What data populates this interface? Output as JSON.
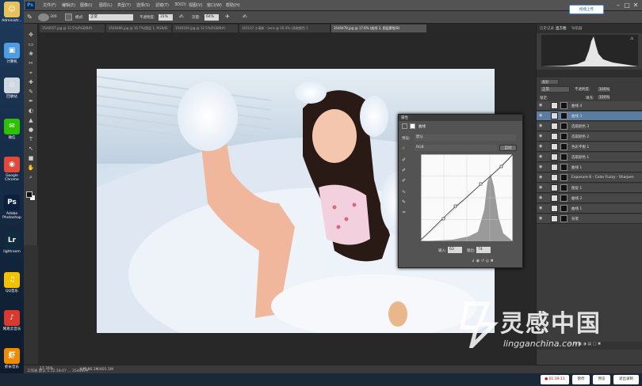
{
  "desktop": {
    "icons": [
      {
        "label": "Administr...",
        "glyph": "☺",
        "color": "#e8c15a"
      },
      {
        "label": "计算机",
        "glyph": "▣",
        "color": "#4d9de0"
      },
      {
        "label": "回收站",
        "glyph": "♲",
        "color": "#cfd8e0"
      },
      {
        "label": "微信",
        "glyph": "✉",
        "color": "#2dc100"
      },
      {
        "label": "Google Chrome",
        "glyph": "◉",
        "color": "#e14a3a"
      },
      {
        "label": "Adobe Photoshop",
        "glyph": "Ps",
        "color": "#0c1f3f"
      },
      {
        "label": "lightroom",
        "glyph": "Lr",
        "color": "#102a3e"
      },
      {
        "label": "QQ音乐",
        "glyph": "♫",
        "color": "#f2c200"
      },
      {
        "label": "网易云音乐",
        "glyph": "♪",
        "color": "#d83a30"
      },
      {
        "label": "虾米音乐",
        "glyph": "虾",
        "color": "#f08a00"
      }
    ]
  },
  "app": {
    "logo": "Ps",
    "menu": [
      "文件(F)",
      "编辑(E)",
      "图像(I)",
      "图层(L)",
      "类型(Y)",
      "选择(S)",
      "滤镜(T)",
      "3D(D)",
      "视图(V)",
      "窗口(W)",
      "帮助(H)"
    ],
    "minimize": "–",
    "maximize": "□",
    "close": "✕",
    "upload_button": "拖拽上传"
  },
  "options": {
    "brush_size": "300",
    "mode_label": "模式:",
    "mode_value": "正常",
    "opacity_label": "不透明度:",
    "opacity_value": "31%",
    "flow_label": "流量:",
    "flow_value": "64%"
  },
  "tabs": [
    "3540057.jpg @ 12.5%(RGB/8#)",
    "3540486.jpg @ 16.7%(图层 1, RGB/8)",
    "3540169.jpg @ 12.5%(RGB/8#)",
    "163137 小清新 - Lens @ 16.4% (选取颜色 1",
    "3540478.jpg @ 17.8% (曲线 3, 图层蒙版/8)"
  ],
  "status": {
    "zoom": "17.76%",
    "doc": "文档:86.1M/401.1M",
    "bottom_left": "工作表 默认 1:12:18.67 ... 3540479"
  },
  "curves": {
    "title": "属性",
    "panel_name": "曲线",
    "preset_label": "预设:",
    "preset_value": "默认",
    "channel_value": "RGB",
    "auto_button": "自动",
    "input_label": "输入:",
    "input_value": "63",
    "output_label": "输出:",
    "output_value": "74"
  },
  "right_panel": {
    "tabs": [
      "历史记录",
      "直方图",
      "导航器"
    ],
    "kind_label": "类型",
    "blend_mode": "正常",
    "opacity_label": "不透明度:",
    "opacity_value": "100%",
    "lock_label": "锁定:",
    "fill_label": "填充:",
    "fill_value": "100%",
    "layers": [
      {
        "name": "曲线 4",
        "selected": false
      },
      {
        "name": "曲线 3",
        "selected": true
      },
      {
        "name": "选取颜色 3",
        "selected": false
      },
      {
        "name": "选取颜色 2",
        "selected": false
      },
      {
        "name": "色彩平衡 1",
        "selected": false
      },
      {
        "name": "选取颜色 1",
        "selected": false
      },
      {
        "name": "曲线 1",
        "selected": false
      },
      {
        "name": "Exposure 6 - Color Fuzzy - Sharpen",
        "selected": false
      },
      {
        "name": "图层 1",
        "selected": false
      },
      {
        "name": "曲线 2",
        "selected": false
      },
      {
        "name": "曲线 1",
        "selected": false
      },
      {
        "name": "背景",
        "selected": false
      }
    ]
  },
  "taskbar": {
    "timer": "01:39:11",
    "pause_button": "暂停",
    "preview_button": "预览",
    "exit_button": "退出录制"
  },
  "watermark": {
    "text": "灵感中国",
    "url": "lingganchina.com"
  }
}
